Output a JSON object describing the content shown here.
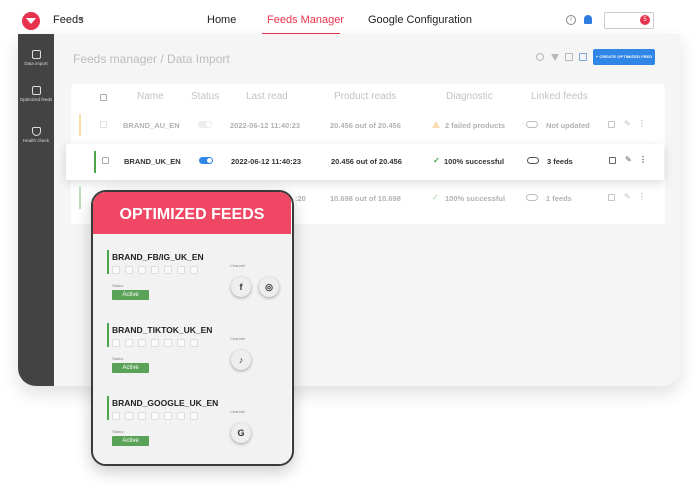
{
  "app": {
    "title": "Feeds"
  },
  "nav": {
    "tabs": [
      {
        "label": "Home"
      },
      {
        "label": "Feeds Manager"
      },
      {
        "label": "Google Configuration"
      }
    ]
  },
  "user": {
    "badge": "5"
  },
  "sidebar": {
    "items": [
      {
        "label": "Data import"
      },
      {
        "label": "Optimized feeds"
      },
      {
        "label": "Health check"
      }
    ]
  },
  "page": {
    "breadcrumb": "Feeds manager / Data Import",
    "create_label": "+ CREATE OPTIMIZED FEED"
  },
  "table": {
    "headers": [
      "Name",
      "Status",
      "Last read",
      "Product reads",
      "Diagnostic",
      "Linked feeds"
    ],
    "rows": [
      {
        "name": "BRAND_AU_EN",
        "status_on": false,
        "last_read": "2022-06-12  11:40:23",
        "product_reads": "20.456 out of 20.456",
        "diagnostic": "2 failed products",
        "linked": "Not updated",
        "bar_color": "#f5a623"
      },
      {
        "name": "BRAND_UK_EN",
        "status_on": true,
        "last_read": "2022-06-12  11:40:23",
        "product_reads": "20.456 out of 20.456",
        "diagnostic": "100% successful",
        "linked": "3 feeds",
        "bar_color": "#4aa64c"
      },
      {
        "name": "",
        "status_on": false,
        "last_read": ":20",
        "product_reads": "10.698 out of 10.698",
        "diagnostic": "100% successful",
        "linked": "1 feeds",
        "bar_color": "#4aa64c"
      }
    ]
  },
  "optimized": {
    "title": "OPTIMIZED FEEDS",
    "status_label": "Status",
    "channel_label": "Channel",
    "active_label": "Active",
    "feeds": [
      {
        "name": "BRAND_FB/IG_UK_EN",
        "channels": [
          "facebook-icon",
          "instagram-icon"
        ]
      },
      {
        "name": "BRAND_TIKTOK_UK_EN",
        "channels": [
          "tiktok-icon"
        ]
      },
      {
        "name": "BRAND_GOOGLE_UK_EN",
        "channels": [
          "google-icon"
        ]
      }
    ]
  }
}
